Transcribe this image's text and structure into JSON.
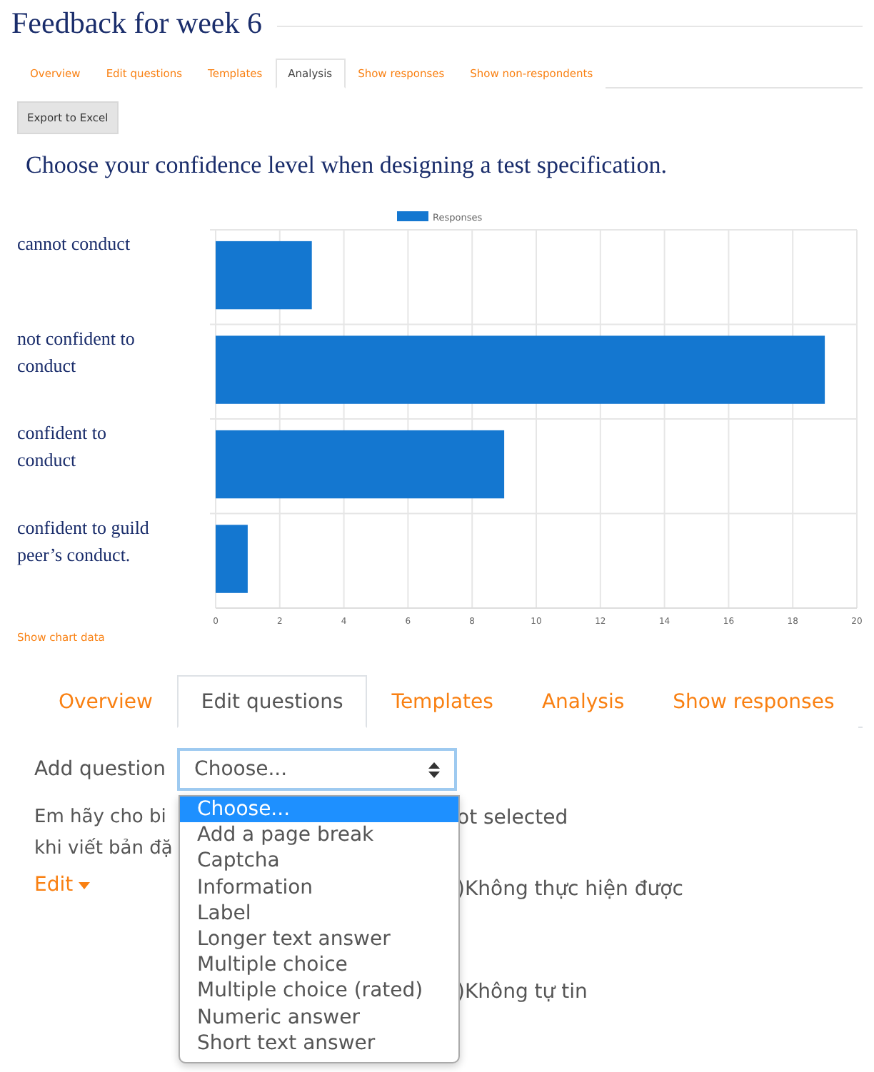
{
  "page_title": "Feedback for week 6",
  "tabs": [
    {
      "label": "Overview",
      "selected": false
    },
    {
      "label": "Edit questions",
      "selected": false
    },
    {
      "label": "Templates",
      "selected": false
    },
    {
      "label": "Analysis",
      "selected": true
    },
    {
      "label": "Show responses",
      "selected": false
    },
    {
      "label": "Show non-respondents",
      "selected": false
    }
  ],
  "export_button": "Export to Excel",
  "question": "Choose your confidence level when designing a test specification.",
  "chart": {
    "chart_data": {
      "type": "bar",
      "orientation": "horizontal",
      "categories": [
        "cannot conduct",
        "not confident to conduct",
        "confident to conduct",
        "confident to guild peer’s conduct."
      ],
      "series": [
        {
          "name": "Responses",
          "color": "#1477d0",
          "values": [
            3,
            19,
            9,
            1
          ]
        }
      ],
      "xlim": [
        0,
        20
      ],
      "grid": true,
      "xticks": [
        0,
        2,
        4,
        6,
        8,
        10,
        12,
        14,
        16,
        18,
        20
      ]
    }
  },
  "show_chart_data": "Show chart data",
  "editor": {
    "tabs": [
      {
        "label": "Overview",
        "selected": false
      },
      {
        "label": "Edit questions",
        "selected": true
      },
      {
        "label": "Templates",
        "selected": false
      },
      {
        "label": "Analysis",
        "selected": false
      },
      {
        "label": "Show responses",
        "selected": false
      }
    ],
    "add_question_label": "Add question",
    "select_value": "Choose...",
    "options": [
      {
        "label": "Choose...",
        "selected": true
      },
      {
        "label": "Add a page break",
        "selected": false
      },
      {
        "label": "Captcha",
        "selected": false
      },
      {
        "label": "Information",
        "selected": false
      },
      {
        "label": "Label",
        "selected": false
      },
      {
        "label": "Longer text answer",
        "selected": false
      },
      {
        "label": "Multiple choice",
        "selected": false
      },
      {
        "label": "Multiple choice (rated)",
        "selected": false
      },
      {
        "label": "Numeric answer",
        "selected": false
      },
      {
        "label": "Short text answer",
        "selected": false
      }
    ],
    "left_texts": [
      "Em hãy cho bi",
      "khi viết bản đặ"
    ],
    "edit_menu": "Edit",
    "right_texts": [
      "ot selected",
      ")Không thực hiện được",
      ")Không tự tin"
    ]
  }
}
